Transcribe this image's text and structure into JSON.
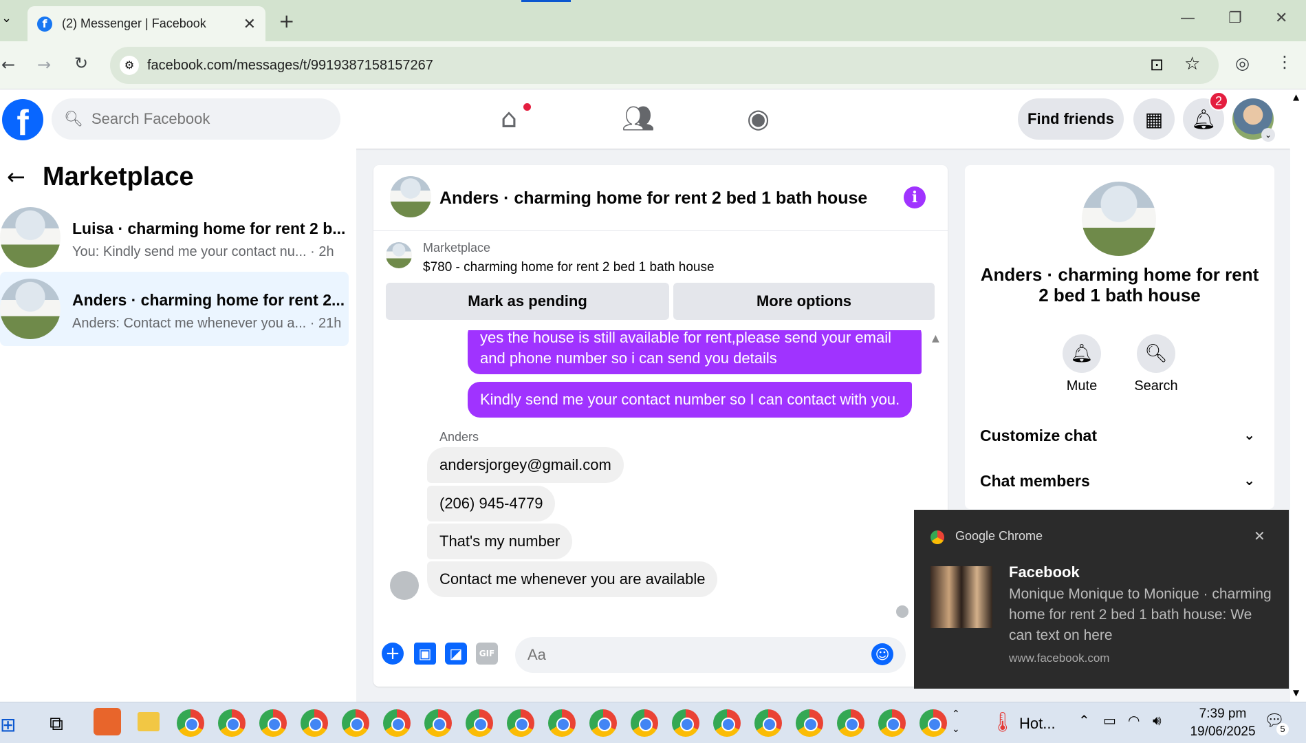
{
  "browser": {
    "tab_title": "(2) Messenger | Facebook",
    "url": "facebook.com/messages/t/9919387158157267"
  },
  "fb": {
    "search_placeholder": "Search Facebook",
    "find_friends": "Find friends",
    "notification_count": "2"
  },
  "left": {
    "title": "Marketplace",
    "conversations": [
      {
        "name": "Luisa · charming home for rent 2 b...",
        "snippet": "You: Kindly send me your contact nu...",
        "time": "· 2h",
        "selected": false
      },
      {
        "name": "Anders · charming home for rent 2...",
        "snippet": "Anders: Contact me whenever you a...",
        "time": "· 21h",
        "selected": true
      }
    ]
  },
  "chat": {
    "title": "Anders · charming home for rent 2 bed 1 bath house",
    "marketplace_label": "Marketplace",
    "listing": "$780 - charming home for rent 2 bed 1 bath house",
    "mark_pending": "Mark as pending",
    "more_options": "More options",
    "outgoing": [
      "yes the house is still available for rent,please send your email and phone number so i can send you details",
      "Kindly send me your contact number so I can contact with you."
    ],
    "sender": "Anders",
    "incoming": [
      "andersjorgey@gmail.com",
      "(206) 945-4779",
      "That's my number",
      "Contact me whenever you are available"
    ],
    "composer_placeholder": "Aa"
  },
  "right": {
    "name": "Anders · charming home for rent 2 bed 1 bath house",
    "mute": "Mute",
    "search": "Search",
    "customize": "Customize chat",
    "members": "Chat members"
  },
  "notification": {
    "app": "Google Chrome",
    "title": "Facebook",
    "body": "Monique Monique to Monique · charming home for rent 2 bed 1 bath house: We can text on here",
    "source": "www.facebook.com"
  },
  "taskbar": {
    "weather": "Hot...",
    "time": "7:39 pm",
    "date": "19/06/2025",
    "notif_count": "5"
  }
}
